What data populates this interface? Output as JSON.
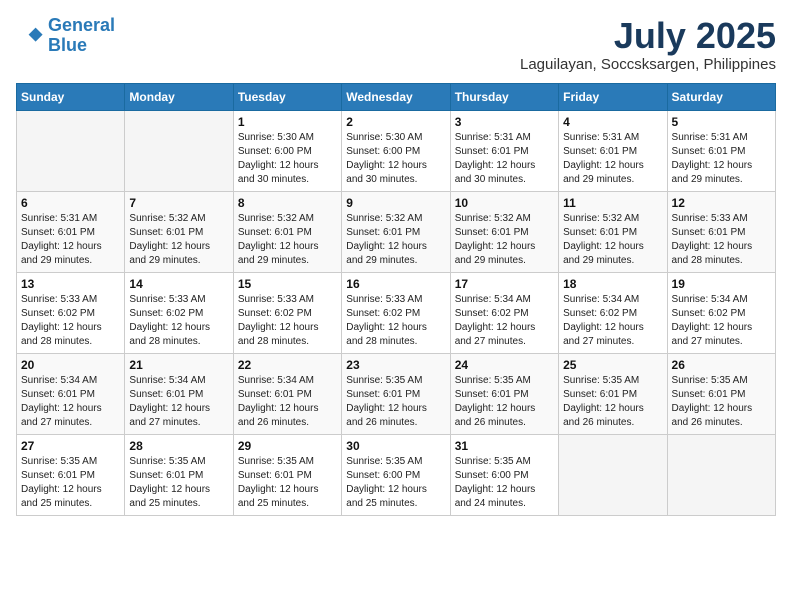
{
  "header": {
    "logo_line1": "General",
    "logo_line2": "Blue",
    "month_year": "July 2025",
    "location": "Laguilayan, Soccsksargen, Philippines"
  },
  "weekdays": [
    "Sunday",
    "Monday",
    "Tuesday",
    "Wednesday",
    "Thursday",
    "Friday",
    "Saturday"
  ],
  "weeks": [
    [
      {
        "day": "",
        "sunrise": "",
        "sunset": "",
        "daylight": "",
        "empty": true
      },
      {
        "day": "",
        "sunrise": "",
        "sunset": "",
        "daylight": "",
        "empty": true
      },
      {
        "day": "1",
        "sunrise": "Sunrise: 5:30 AM",
        "sunset": "Sunset: 6:00 PM",
        "daylight": "Daylight: 12 hours and 30 minutes.",
        "empty": false
      },
      {
        "day": "2",
        "sunrise": "Sunrise: 5:30 AM",
        "sunset": "Sunset: 6:00 PM",
        "daylight": "Daylight: 12 hours and 30 minutes.",
        "empty": false
      },
      {
        "day": "3",
        "sunrise": "Sunrise: 5:31 AM",
        "sunset": "Sunset: 6:01 PM",
        "daylight": "Daylight: 12 hours and 30 minutes.",
        "empty": false
      },
      {
        "day": "4",
        "sunrise": "Sunrise: 5:31 AM",
        "sunset": "Sunset: 6:01 PM",
        "daylight": "Daylight: 12 hours and 29 minutes.",
        "empty": false
      },
      {
        "day": "5",
        "sunrise": "Sunrise: 5:31 AM",
        "sunset": "Sunset: 6:01 PM",
        "daylight": "Daylight: 12 hours and 29 minutes.",
        "empty": false
      }
    ],
    [
      {
        "day": "6",
        "sunrise": "Sunrise: 5:31 AM",
        "sunset": "Sunset: 6:01 PM",
        "daylight": "Daylight: 12 hours and 29 minutes.",
        "empty": false
      },
      {
        "day": "7",
        "sunrise": "Sunrise: 5:32 AM",
        "sunset": "Sunset: 6:01 PM",
        "daylight": "Daylight: 12 hours and 29 minutes.",
        "empty": false
      },
      {
        "day": "8",
        "sunrise": "Sunrise: 5:32 AM",
        "sunset": "Sunset: 6:01 PM",
        "daylight": "Daylight: 12 hours and 29 minutes.",
        "empty": false
      },
      {
        "day": "9",
        "sunrise": "Sunrise: 5:32 AM",
        "sunset": "Sunset: 6:01 PM",
        "daylight": "Daylight: 12 hours and 29 minutes.",
        "empty": false
      },
      {
        "day": "10",
        "sunrise": "Sunrise: 5:32 AM",
        "sunset": "Sunset: 6:01 PM",
        "daylight": "Daylight: 12 hours and 29 minutes.",
        "empty": false
      },
      {
        "day": "11",
        "sunrise": "Sunrise: 5:32 AM",
        "sunset": "Sunset: 6:01 PM",
        "daylight": "Daylight: 12 hours and 29 minutes.",
        "empty": false
      },
      {
        "day": "12",
        "sunrise": "Sunrise: 5:33 AM",
        "sunset": "Sunset: 6:01 PM",
        "daylight": "Daylight: 12 hours and 28 minutes.",
        "empty": false
      }
    ],
    [
      {
        "day": "13",
        "sunrise": "Sunrise: 5:33 AM",
        "sunset": "Sunset: 6:02 PM",
        "daylight": "Daylight: 12 hours and 28 minutes.",
        "empty": false
      },
      {
        "day": "14",
        "sunrise": "Sunrise: 5:33 AM",
        "sunset": "Sunset: 6:02 PM",
        "daylight": "Daylight: 12 hours and 28 minutes.",
        "empty": false
      },
      {
        "day": "15",
        "sunrise": "Sunrise: 5:33 AM",
        "sunset": "Sunset: 6:02 PM",
        "daylight": "Daylight: 12 hours and 28 minutes.",
        "empty": false
      },
      {
        "day": "16",
        "sunrise": "Sunrise: 5:33 AM",
        "sunset": "Sunset: 6:02 PM",
        "daylight": "Daylight: 12 hours and 28 minutes.",
        "empty": false
      },
      {
        "day": "17",
        "sunrise": "Sunrise: 5:34 AM",
        "sunset": "Sunset: 6:02 PM",
        "daylight": "Daylight: 12 hours and 27 minutes.",
        "empty": false
      },
      {
        "day": "18",
        "sunrise": "Sunrise: 5:34 AM",
        "sunset": "Sunset: 6:02 PM",
        "daylight": "Daylight: 12 hours and 27 minutes.",
        "empty": false
      },
      {
        "day": "19",
        "sunrise": "Sunrise: 5:34 AM",
        "sunset": "Sunset: 6:02 PM",
        "daylight": "Daylight: 12 hours and 27 minutes.",
        "empty": false
      }
    ],
    [
      {
        "day": "20",
        "sunrise": "Sunrise: 5:34 AM",
        "sunset": "Sunset: 6:01 PM",
        "daylight": "Daylight: 12 hours and 27 minutes.",
        "empty": false
      },
      {
        "day": "21",
        "sunrise": "Sunrise: 5:34 AM",
        "sunset": "Sunset: 6:01 PM",
        "daylight": "Daylight: 12 hours and 27 minutes.",
        "empty": false
      },
      {
        "day": "22",
        "sunrise": "Sunrise: 5:34 AM",
        "sunset": "Sunset: 6:01 PM",
        "daylight": "Daylight: 12 hours and 26 minutes.",
        "empty": false
      },
      {
        "day": "23",
        "sunrise": "Sunrise: 5:35 AM",
        "sunset": "Sunset: 6:01 PM",
        "daylight": "Daylight: 12 hours and 26 minutes.",
        "empty": false
      },
      {
        "day": "24",
        "sunrise": "Sunrise: 5:35 AM",
        "sunset": "Sunset: 6:01 PM",
        "daylight": "Daylight: 12 hours and 26 minutes.",
        "empty": false
      },
      {
        "day": "25",
        "sunrise": "Sunrise: 5:35 AM",
        "sunset": "Sunset: 6:01 PM",
        "daylight": "Daylight: 12 hours and 26 minutes.",
        "empty": false
      },
      {
        "day": "26",
        "sunrise": "Sunrise: 5:35 AM",
        "sunset": "Sunset: 6:01 PM",
        "daylight": "Daylight: 12 hours and 26 minutes.",
        "empty": false
      }
    ],
    [
      {
        "day": "27",
        "sunrise": "Sunrise: 5:35 AM",
        "sunset": "Sunset: 6:01 PM",
        "daylight": "Daylight: 12 hours and 25 minutes.",
        "empty": false
      },
      {
        "day": "28",
        "sunrise": "Sunrise: 5:35 AM",
        "sunset": "Sunset: 6:01 PM",
        "daylight": "Daylight: 12 hours and 25 minutes.",
        "empty": false
      },
      {
        "day": "29",
        "sunrise": "Sunrise: 5:35 AM",
        "sunset": "Sunset: 6:01 PM",
        "daylight": "Daylight: 12 hours and 25 minutes.",
        "empty": false
      },
      {
        "day": "30",
        "sunrise": "Sunrise: 5:35 AM",
        "sunset": "Sunset: 6:00 PM",
        "daylight": "Daylight: 12 hours and 25 minutes.",
        "empty": false
      },
      {
        "day": "31",
        "sunrise": "Sunrise: 5:35 AM",
        "sunset": "Sunset: 6:00 PM",
        "daylight": "Daylight: 12 hours and 24 minutes.",
        "empty": false
      },
      {
        "day": "",
        "sunrise": "",
        "sunset": "",
        "daylight": "",
        "empty": true
      },
      {
        "day": "",
        "sunrise": "",
        "sunset": "",
        "daylight": "",
        "empty": true
      }
    ]
  ]
}
